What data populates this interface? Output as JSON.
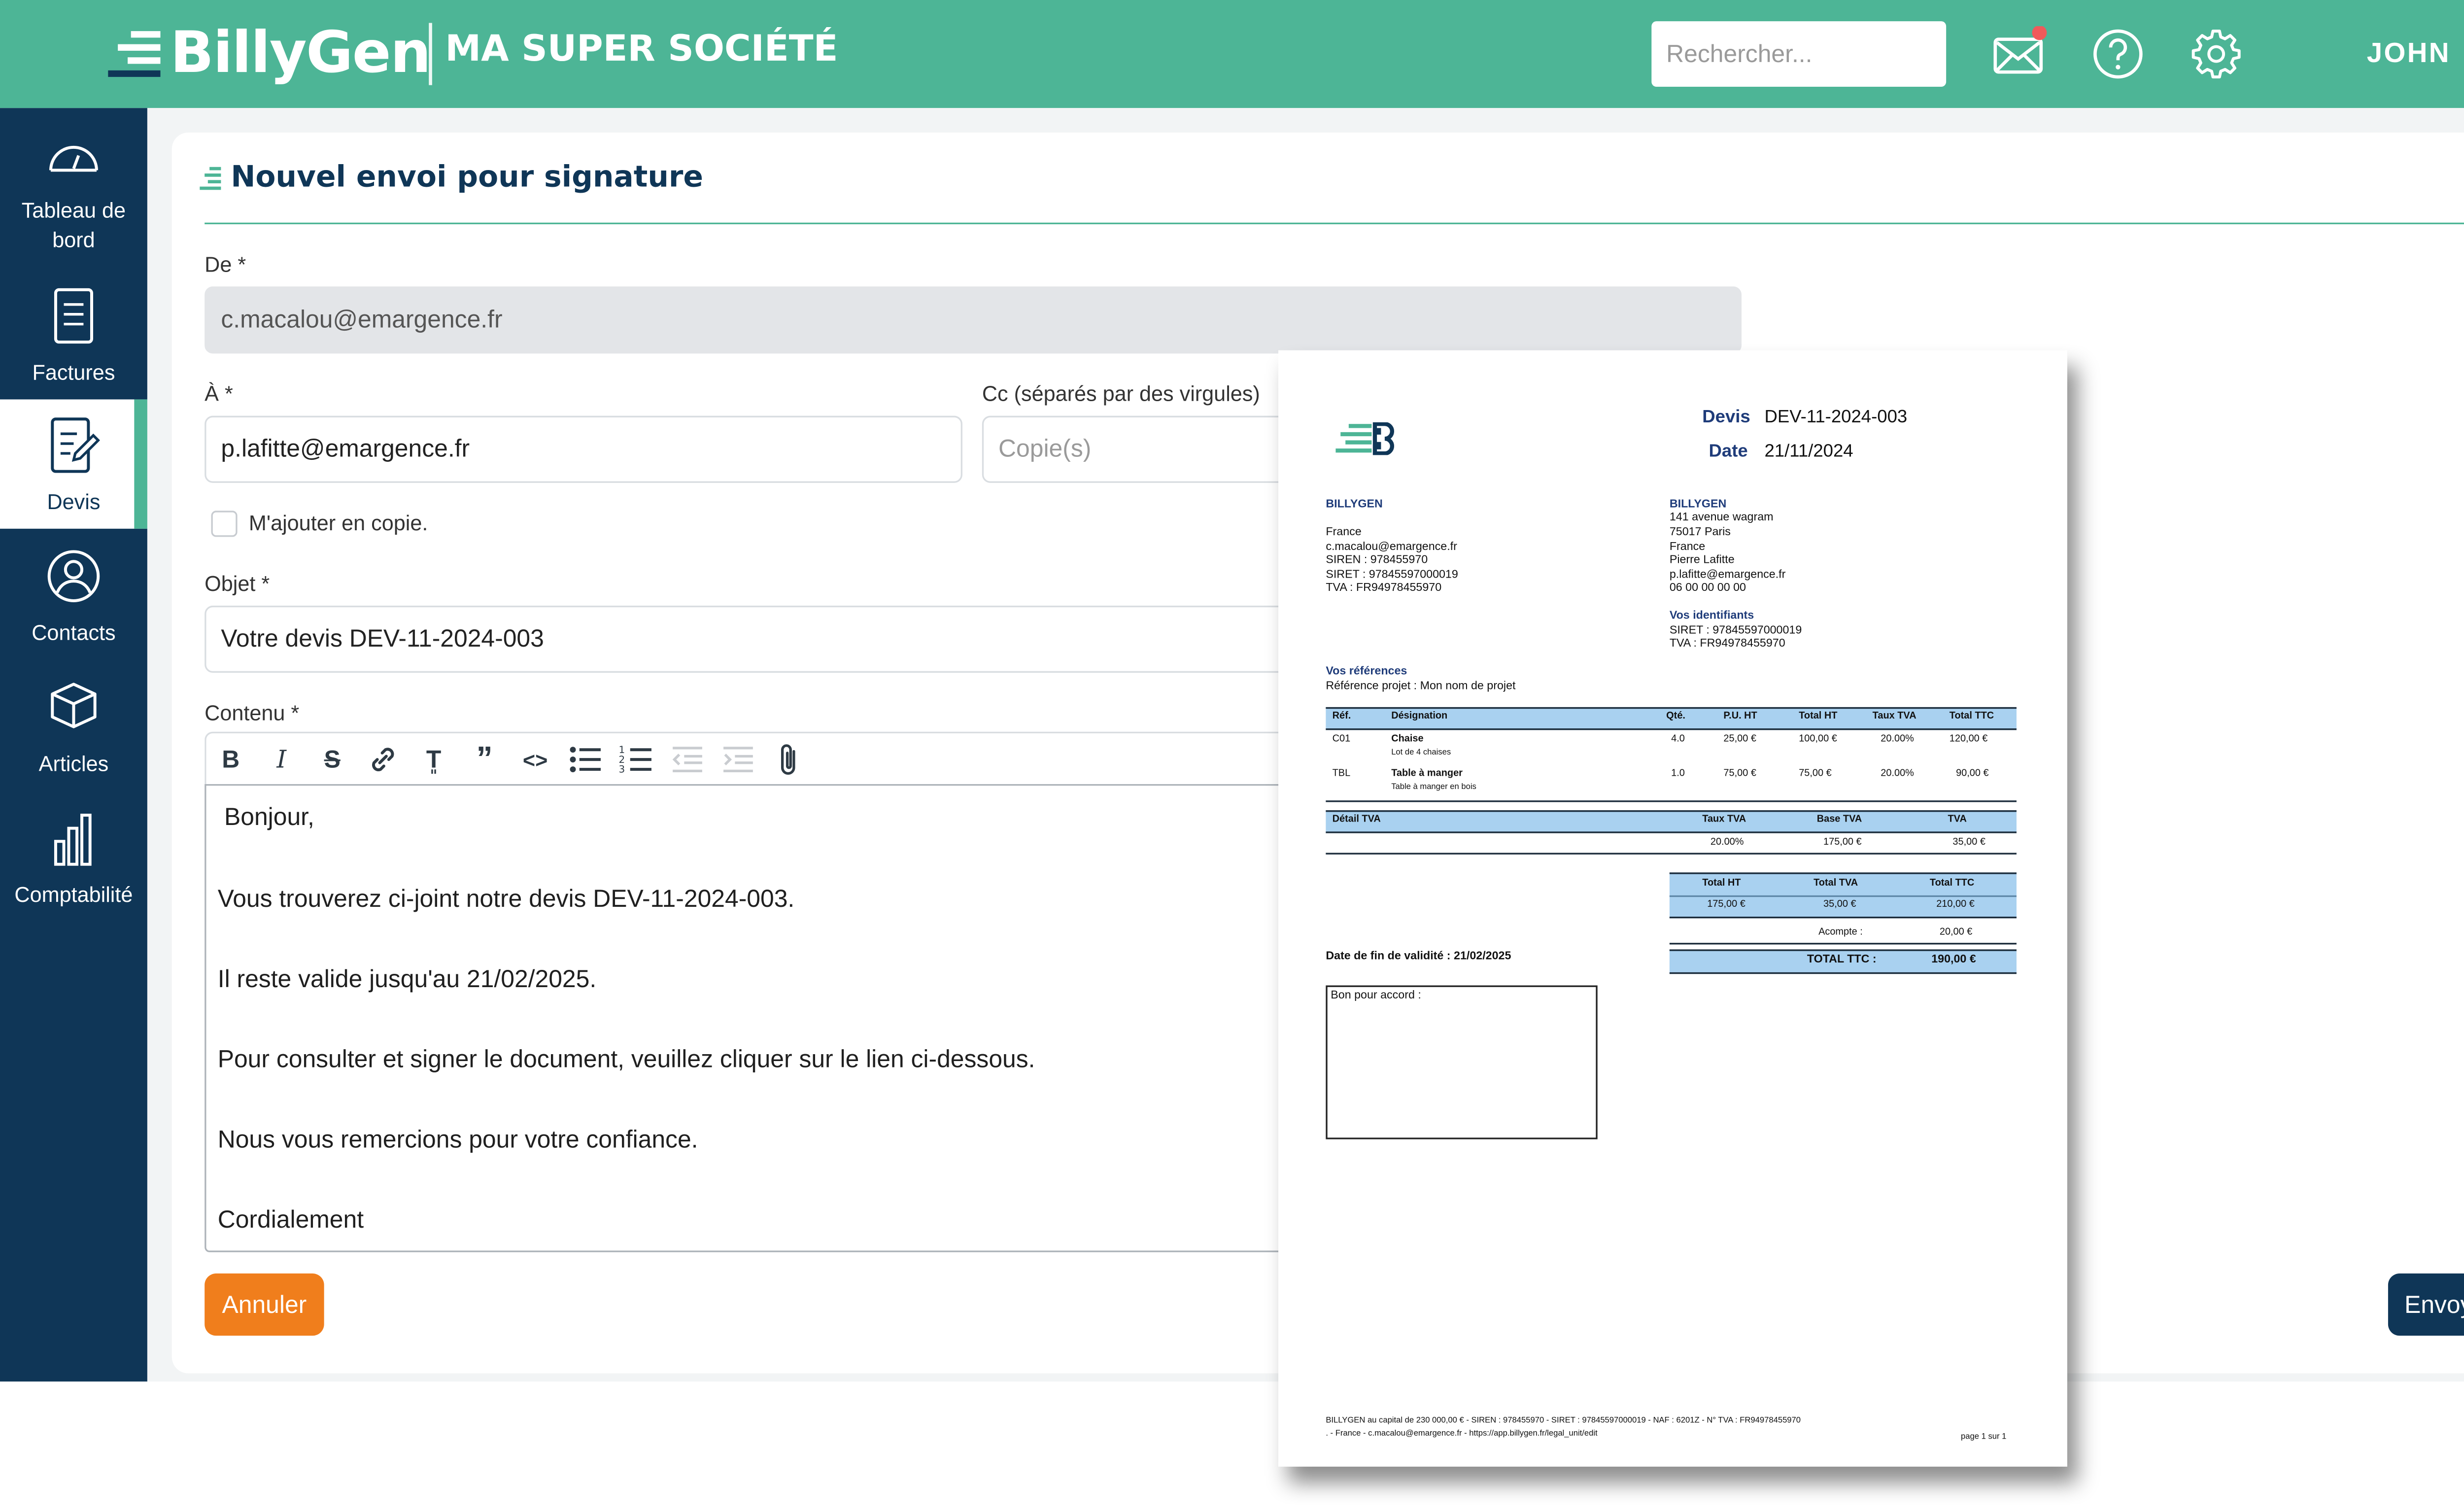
{
  "brand": {
    "logo_text": "BillyGen",
    "company": "MA SUPER SOCIÉTÉ"
  },
  "header": {
    "search_placeholder": "Recherche​r...",
    "user": "JOHN"
  },
  "colors": {
    "brand_green": "#4db596",
    "navy": "#0f3657",
    "orange": "#f07e1c",
    "table_header_blue": "#a9d1f0"
  },
  "sidebar": {
    "items": [
      {
        "label": "Tableau de bord",
        "icon": "dashboard-gauge-icon"
      },
      {
        "label": "Factures",
        "icon": "invoice-icon"
      },
      {
        "label": "Devis",
        "icon": "quote-edit-icon"
      },
      {
        "label": "Contacts",
        "icon": "user-circle-icon"
      },
      {
        "label": "Articles",
        "icon": "box-icon"
      },
      {
        "label": "Comptabilité",
        "icon": "bar-chart-icon"
      }
    ]
  },
  "form": {
    "title": "Nouvel envoi pour signature",
    "from_label": "De *",
    "from_value": "c.macalou@emargence.fr",
    "to_label": "À *",
    "to_value": "p.lafitte@emargence.fr",
    "cc_label": "Cc (séparés par des virgules)",
    "cc_placeholder": "Copie(s)",
    "self_copy_label": "M'ajouter en copie.",
    "subject_label": "Objet *",
    "subject_value": "Votre devis DEV-11-2024-003",
    "content_label": "Contenu *",
    "content_lines": [
      "Bonjour,",
      "Vous trouverez ci-joint notre devis DEV-11-2024-003.",
      "Il reste valide jusqu'au 21/02/2025.",
      "Pour consulter et signer le document, veuillez cliquer sur le lien ci-dessous.",
      "Nous vous remercions pour votre confiance.",
      "Cordialement"
    ],
    "cancel_label": "Annuler",
    "send_label": "Envoyer"
  },
  "document": {
    "devis_label": "Devis",
    "devis_number": "DEV-11-2024-003",
    "date_label": "Date",
    "date_value": "21/11/2024",
    "sender": {
      "name": "BILLYGEN",
      "lines": [
        "France",
        "c.macalou@emargence.fr",
        "SIREN : 978455970",
        "SIRET : 97845597000019",
        "TVA : FR94978455970"
      ]
    },
    "client": {
      "name": "BILLYGEN",
      "lines": [
        "141 avenue wagram",
        "75017  Paris",
        "France",
        "Pierre Lafitte",
        "p.lafitte@emargence.fr",
        "06 00 00 00 00"
      ]
    },
    "ids_title": "Vos identifiants",
    "ids_lines": [
      "SIRET : 97845597000019",
      "TVA : FR94978455970"
    ],
    "refs_title": "Vos références",
    "refs_line": "Référence projet : Mon nom de projet",
    "table_headers": [
      "Réf.",
      "Désignation",
      "Qté.",
      "P.U. HT",
      "Total HT",
      "Taux TVA",
      "Total TTC"
    ],
    "rows": [
      {
        "ref": "C01",
        "name": "Chaise",
        "desc": "Lot de 4 chaises",
        "qty": "4.0",
        "pu": "25,00 €",
        "total_ht": "100,00 €",
        "rate": "20.00%",
        "total_ttc": "120,00 €"
      },
      {
        "ref": "TBL",
        "name": "Table à manger",
        "desc": "Table à manger en bois",
        "qty": "1.0",
        "pu": "75,00 €",
        "total_ht": "75,00 €",
        "rate": "20.00%",
        "total_ttc": "90,00 €"
      }
    ],
    "vat_headers": [
      "Détail TVA",
      "Taux TVA",
      "Base TVA",
      "TVA"
    ],
    "vat_row": [
      "20.00%",
      "175,00 €",
      "35,00 €"
    ],
    "totals_headers": [
      "Total HT",
      "Total TVA",
      "Total TTC"
    ],
    "totals_values": [
      "175,00 €",
      "35,00 €",
      "210,00 €"
    ],
    "acompte_label": "Acompte :",
    "acompte_value": "20,00 €",
    "total_ttc_label": "TOTAL TTC :",
    "total_ttc_value": "190,00 €",
    "validity": "Date de fin de validité : 21/02/2025",
    "signature_label": "Bon pour accord :",
    "footer_line1": "BILLYGEN  au capital de 230 000,00 € - SIREN : 978455970 - SIRET : 97845597000019 - NAF : 6201Z - N° TVA : FR94978455970",
    "footer_line2": ".   - France - c.macalou@emargence.fr - https://app.billygen.fr/legal_unit/edit",
    "page": "page 1 sur 1"
  }
}
